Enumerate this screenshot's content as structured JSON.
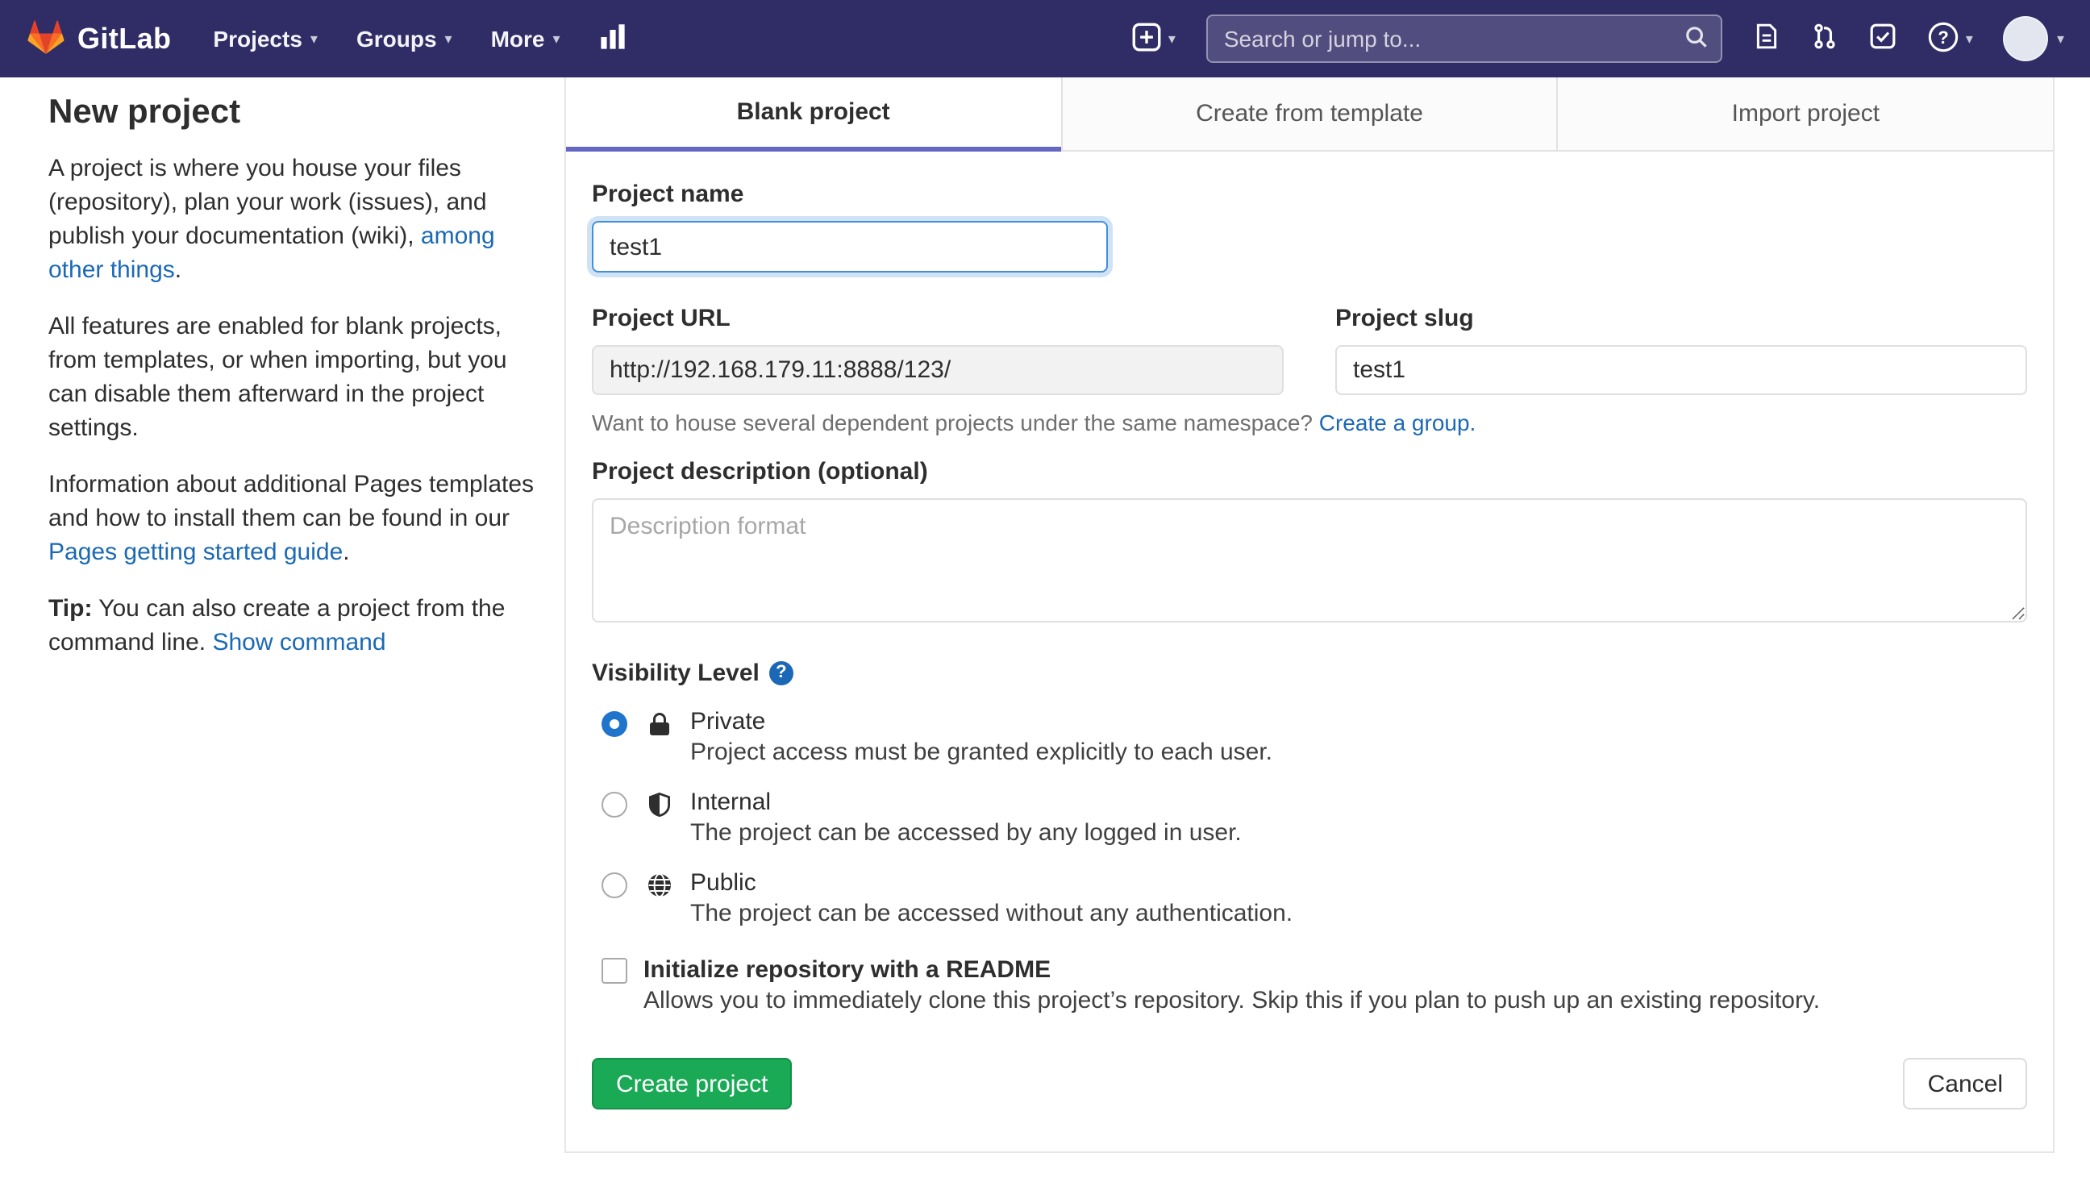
{
  "colors": {
    "navbar_bg": "#302c66",
    "active_tab_underline": "#6666c4",
    "link_blue": "#1b69b6",
    "radio_selected_blue": "#1f75cb",
    "create_button_green": "#1aaa55",
    "logo_red": "#e24329",
    "logo_orange": "#fc6d26",
    "logo_yellow": "#fca326"
  },
  "icons": {
    "chevron_down": "▾",
    "help_glyph": "?"
  },
  "navbar": {
    "brand": "GitLab",
    "menus": [
      {
        "label": "Projects"
      },
      {
        "label": "Groups"
      },
      {
        "label": "More"
      }
    ],
    "search": {
      "placeholder": "Search or jump to..."
    }
  },
  "sidebar": {
    "title": "New project",
    "para1_pre": "A project is where you house your files (repository), plan your work (issues), and publish your documentation (wiki), ",
    "para1_link": "among other things",
    "para1_post": ".",
    "para2": "All features are enabled for blank projects, from templates, or when importing, but you can disable them afterward in the project settings.",
    "para3_pre": "Information about additional Pages templates and how to install them can be found in our ",
    "para3_link": "Pages getting started guide",
    "para3_post": ".",
    "tip_label": "Tip:",
    "tip_text": " You can also create a project from the command line. ",
    "tip_link": "Show command"
  },
  "tabs": [
    {
      "label": "Blank project",
      "active": true
    },
    {
      "label": "Create from template",
      "active": false
    },
    {
      "label": "Import project",
      "active": false
    }
  ],
  "form": {
    "project_name_label": "Project name",
    "project_name_value": "test1",
    "project_url_label": "Project URL",
    "project_url_value": "http://192.168.179.11:8888/123/",
    "project_slug_label": "Project slug",
    "project_slug_value": "test1",
    "namespace_hint_pre": "Want to house several dependent projects under the same namespace? ",
    "namespace_hint_link": "Create a group.",
    "description_label": "Project description (optional)",
    "description_placeholder": "Description format",
    "visibility_label": "Visibility Level",
    "visibility_options": [
      {
        "name": "Private",
        "description": "Project access must be granted explicitly to each user.",
        "selected": true,
        "icon": "lock-icon"
      },
      {
        "name": "Internal",
        "description": "The project can be accessed by any logged in user.",
        "selected": false,
        "icon": "shield-icon"
      },
      {
        "name": "Public",
        "description": "The project can be accessed without any authentication.",
        "selected": false,
        "icon": "globe-icon"
      }
    ],
    "readme_label": "Initialize repository with a README",
    "readme_description": "Allows you to immediately clone this project’s repository. Skip this if you plan to push up an existing repository.",
    "submit_label": "Create project",
    "cancel_label": "Cancel"
  }
}
